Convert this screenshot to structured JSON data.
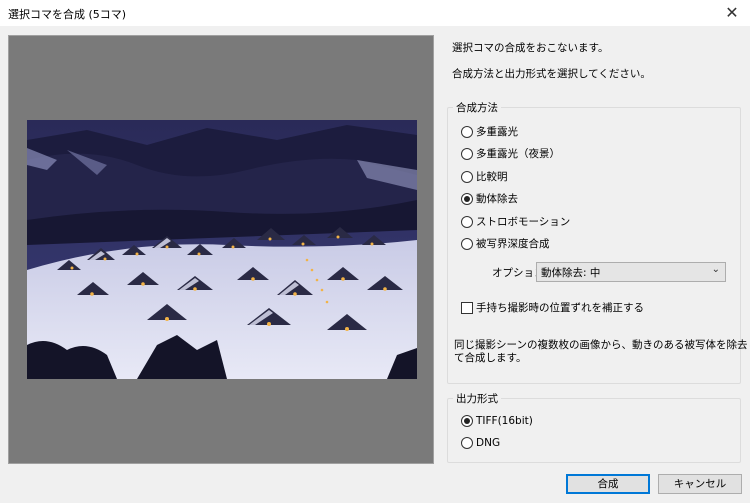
{
  "window": {
    "title": "選択コマを合成 (5コマ)",
    "close_glyph": "✕"
  },
  "intro": {
    "line1": "選択コマの合成をおこないます。",
    "line2": "合成方法と出力形式を選択してください。"
  },
  "method_group": {
    "title": "合成方法",
    "options": [
      "多重露光",
      "多重露光（夜景）",
      "比較明",
      "動体除去",
      "ストロボモーション",
      "被写界深度合成"
    ],
    "selected_index": 3,
    "option_label": "オプション",
    "option_value": "動体除去: 中",
    "align_checkbox": {
      "label": "手持ち撮影時の位置ずれを補正する",
      "checked": false
    },
    "description_line1": "同じ撮影シーンの複数枚の画像から、動きのある被写体を除去し",
    "description_line2": "て合成します。"
  },
  "output_group": {
    "title": "出力形式",
    "options": [
      "TIFF(16bit)",
      "DNG"
    ],
    "selected_index": 0
  },
  "buttons": {
    "ok": "合成",
    "cancel": "キャンセル"
  },
  "colors": {
    "accent": "#0078d7",
    "preview_bg": "#7a7a7a",
    "dialog_bg": "#f0f0f0"
  }
}
